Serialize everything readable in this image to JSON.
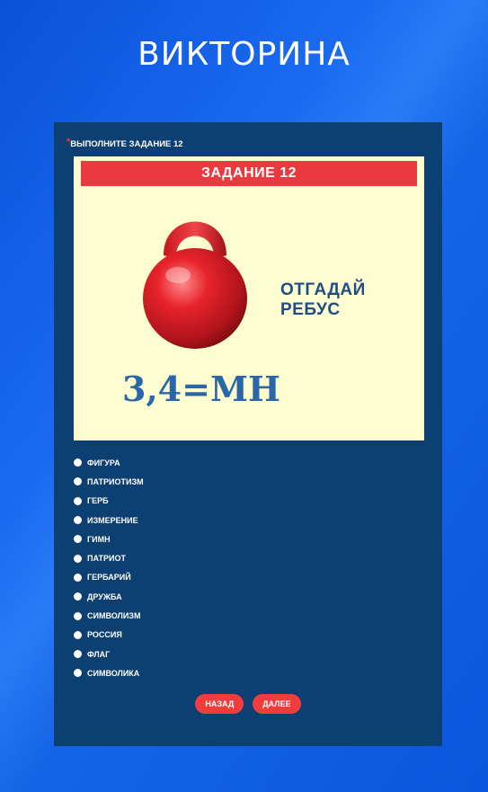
{
  "page": {
    "title": "ВИКТОРИНА"
  },
  "question": {
    "required_mark": "*",
    "label": "ВЫПОЛНИТЕ ЗАДАНИЕ 12"
  },
  "rebus": {
    "header": "ЗАДАНИЕ 12",
    "image_icon": "kettlebell-icon",
    "hint": "ОТГАДАЙ РЕБУС",
    "formula": "3,4=МН"
  },
  "options": [
    {
      "label": "ФИГУРА"
    },
    {
      "label": "ПАТРИОТИЗМ"
    },
    {
      "label": "ГЕРБ"
    },
    {
      "label": "ИЗМЕРЕНИЕ"
    },
    {
      "label": "ГИМН"
    },
    {
      "label": "ПАТРИОТ"
    },
    {
      "label": "ГЕРБАРИЙ"
    },
    {
      "label": "ДРУЖБА"
    },
    {
      "label": "СИМВОЛИЗМ"
    },
    {
      "label": "РОССИЯ"
    },
    {
      "label": "ФЛАГ"
    },
    {
      "label": "СИМВОЛИКА"
    }
  ],
  "buttons": {
    "back_label": "НАЗАД",
    "next_label": "ДАЛЕЕ"
  },
  "colors": {
    "background": "#0b56dc",
    "card": "#0c3f72",
    "rebus_background": "#fefdd0",
    "accent_red": "#ea3a40",
    "formula_blue": "#2a66a8"
  }
}
